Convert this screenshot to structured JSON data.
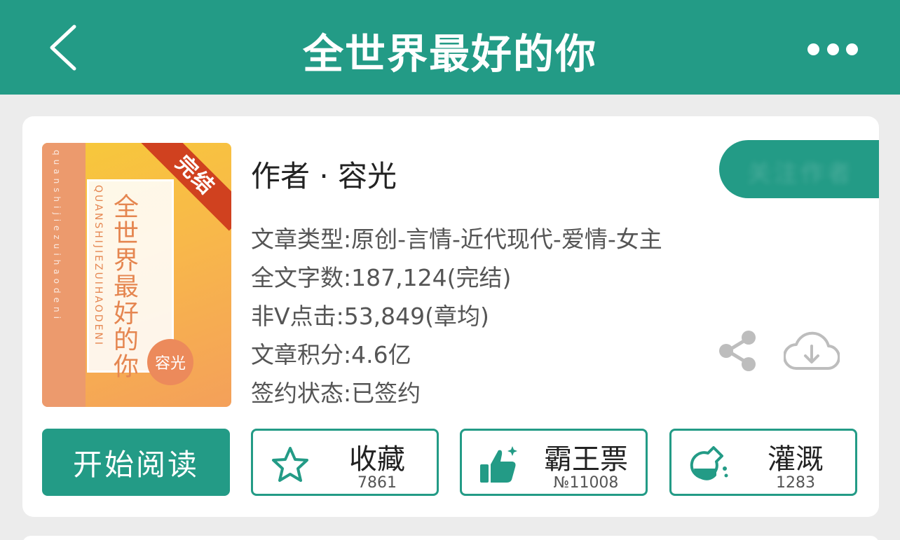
{
  "header": {
    "title": "全世界最好的你",
    "back_icon": "chevron-left-icon",
    "more_icon": "more-horizontal-icon"
  },
  "colors": {
    "brand": "#239b86",
    "ribbon": "#d0411f",
    "cover_accent": "#e58650"
  },
  "cover": {
    "status_ribbon": "完结",
    "title": "全世界最好的你",
    "pinyin": "QUANSHIJIEZUIHAODENI",
    "side_text": "quanshijiezuihaodeni",
    "author": "容光"
  },
  "book": {
    "author_line": "作者 · 容光",
    "pill_text": "关注作者",
    "meta": {
      "type": "文章类型:原创-言情-近代现代-爱情-女主",
      "words": "全文字数:187,124(完结)",
      "clicks": "非V点击:53,849(章均)",
      "score": "文章积分:4.6亿",
      "contract": "签约状态:已签约"
    }
  },
  "actions": {
    "read_label": "开始阅读",
    "favorite": {
      "label": "收藏",
      "count": "7861",
      "icon": "star-icon"
    },
    "ticket": {
      "label": "霸王票",
      "count": "№11008",
      "icon": "thumbs-up-icon"
    },
    "water": {
      "label": "灌溉",
      "count": "1283",
      "icon": "flask-icon"
    },
    "share_icon": "share-icon",
    "download_icon": "cloud-download-icon"
  }
}
